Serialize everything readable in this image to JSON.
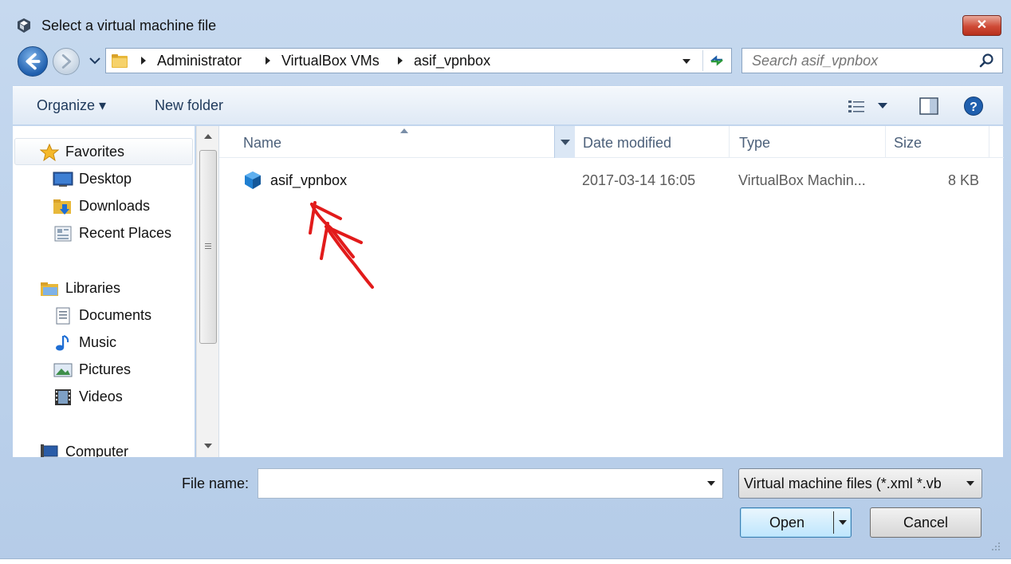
{
  "window": {
    "title": "Select a virtual machine file",
    "close_label": "✕"
  },
  "address": {
    "breadcrumbs": [
      "Administrator",
      "VirtualBox VMs",
      "asif_vpnbox"
    ]
  },
  "search": {
    "placeholder": "Search asif_vpnbox"
  },
  "toolbar": {
    "organize_label": "Organize ▾",
    "new_folder_label": "New folder"
  },
  "nav": {
    "favorites_label": "Favorites",
    "favorites": [
      "Desktop",
      "Downloads",
      "Recent Places"
    ],
    "libraries_label": "Libraries",
    "libraries": [
      "Documents",
      "Music",
      "Pictures",
      "Videos"
    ],
    "computer_label": "Computer"
  },
  "columns": {
    "name": "Name",
    "date": "Date modified",
    "type": "Type",
    "size": "Size"
  },
  "files": [
    {
      "name": "asif_vpnbox",
      "date": "2017-03-14 16:05",
      "type": "VirtualBox Machin...",
      "size": "8 KB"
    }
  ],
  "bottom": {
    "filename_label": "File name:",
    "filename_value": "",
    "filter_value": "Virtual machine files (*.xml *.vb",
    "open_label": "Open",
    "cancel_label": "Cancel"
  },
  "colors": {
    "annotation_arrow": "#e21b1b",
    "vbox_blue": "#1f7fd1"
  }
}
